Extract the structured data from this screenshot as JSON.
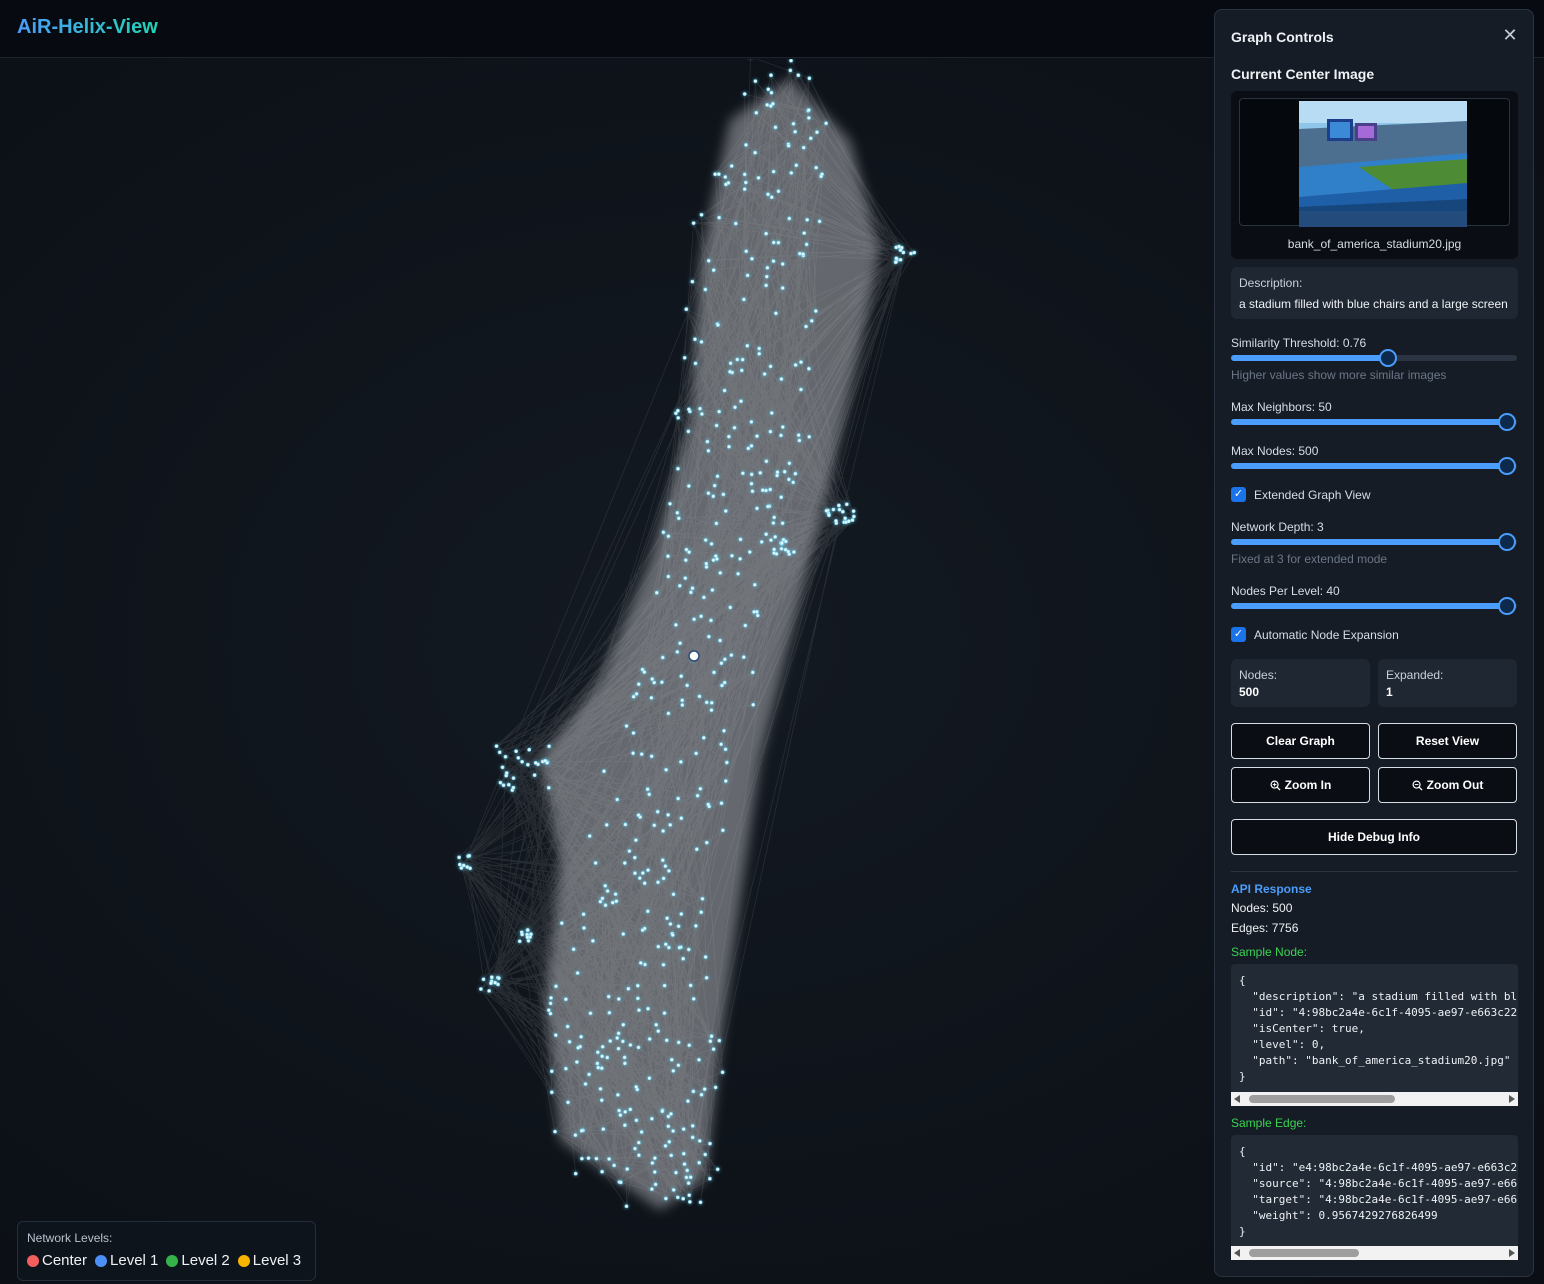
{
  "app": {
    "title": "AiR-Helix-View"
  },
  "legend": {
    "title": "Network Levels:",
    "items": [
      {
        "label": "Center",
        "color": "#f25f5c"
      },
      {
        "label": "Level 1",
        "color": "#4a90f5"
      },
      {
        "label": "Level 2",
        "color": "#36b24a"
      },
      {
        "label": "Level 3",
        "color": "#f7b500"
      }
    ]
  },
  "panel": {
    "title": "Graph Controls",
    "close_icon": "close-icon",
    "current_center_title": "Current Center Image",
    "image_name": "bank_of_america_stadium20.jpg",
    "description_label": "Description:",
    "description": "a stadium filled with blue chairs and a large screen",
    "similarity": {
      "label": "Similarity Threshold: 0.76",
      "value": 0.76,
      "min": 0,
      "max": 1,
      "hint": "Higher values show more similar images"
    },
    "max_neighbors": {
      "label": "Max Neighbors: 50",
      "value": 50,
      "max": 50
    },
    "max_nodes": {
      "label": "Max Nodes: 500",
      "value": 500,
      "max": 500
    },
    "extended_view": {
      "label": "Extended Graph View",
      "checked": true
    },
    "network_depth": {
      "label": "Network Depth: 3",
      "value": 3,
      "max": 3,
      "hint": "Fixed at 3 for extended mode"
    },
    "nodes_per_level": {
      "label": "Nodes Per Level: 40",
      "value": 40,
      "max": 40
    },
    "auto_expand": {
      "label": "Automatic Node Expansion",
      "checked": true
    },
    "stats": {
      "nodes_label": "Nodes:",
      "nodes_value": "500",
      "expanded_label": "Expanded:",
      "expanded_value": "1"
    },
    "buttons": {
      "clear": "Clear Graph",
      "reset": "Reset View",
      "zoom_in": "Zoom In",
      "zoom_out": "Zoom Out",
      "debug": "Hide Debug Info"
    },
    "api": {
      "title": "API Response",
      "nodes": "Nodes: 500",
      "edges": "Edges: 7756",
      "sample_node_title": "Sample Node:",
      "sample_node": "{\n  \"description\": \"a stadium filled with bl\n  \"id\": \"4:98bc2a4e-6c1f-4095-ae97-e663c22\n  \"isCenter\": true,\n  \"level\": 0,\n  \"path\": \"bank_of_america_stadium20.jpg\"\n}",
      "sample_edge_title": "Sample Edge:",
      "sample_edge": "{\n  \"id\": \"e4:98bc2a4e-6c1f-4095-ae97-e663c2\n  \"source\": \"4:98bc2a4e-6c1f-4095-ae97-e66\n  \"target\": \"4:98bc2a4e-6c1f-4095-ae97-e66\n  \"weight\": 0.9567429276826499\n}"
    }
  },
  "colors": {
    "accent": "#4a9dfb",
    "edge": "#c8c8c8",
    "node": "#7fd8f0",
    "success": "#39d353"
  }
}
